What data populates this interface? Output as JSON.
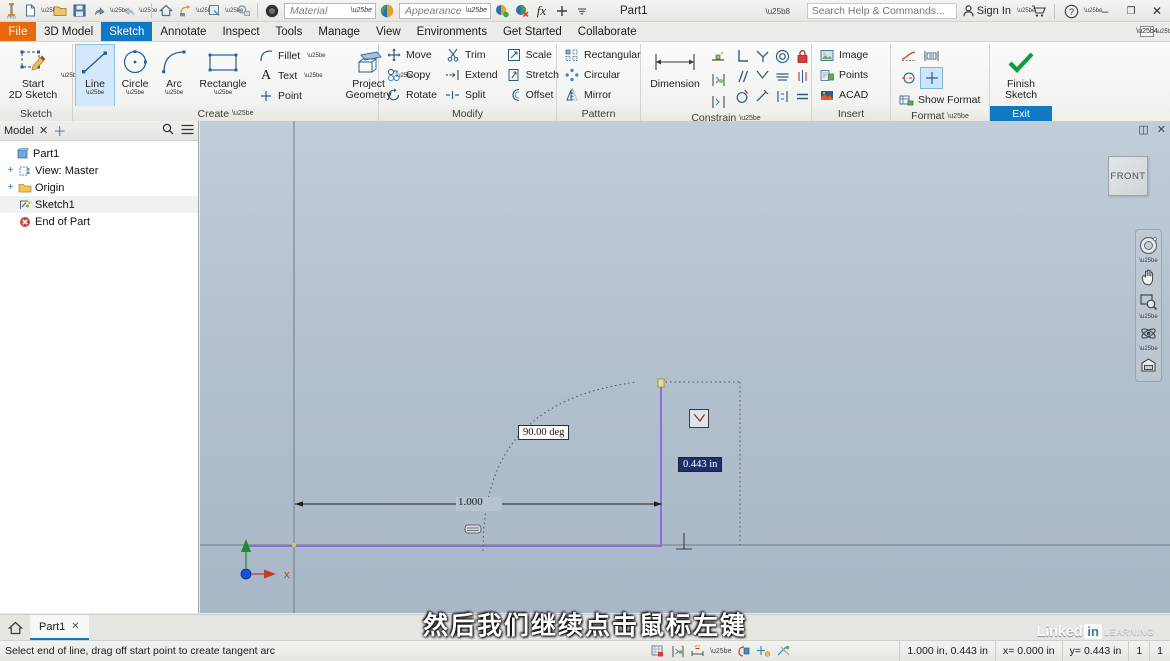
{
  "titlebar": {
    "document_title": "Part1",
    "material_value": "Material",
    "appearance_value": "Appearance",
    "search_placeholder": "Search Help & Commands...",
    "signin_label": "Sign In",
    "minimize_label": "–",
    "restore_label": "❐",
    "close_label": "✕",
    "fx_label": "fx",
    "quick_access": [
      {
        "name": "new-document",
        "glyph": "□"
      },
      {
        "name": "open-document",
        "glyph": "🗁"
      },
      {
        "name": "save-document",
        "glyph": "💾"
      },
      {
        "name": "undo",
        "glyph": "↶"
      },
      {
        "name": "redo",
        "glyph": "↷"
      },
      {
        "name": "home-view",
        "glyph": "⌂"
      },
      {
        "name": "return",
        "glyph": "↩"
      },
      {
        "name": "update",
        "glyph": "◱"
      },
      {
        "name": "select",
        "glyph": "⬚"
      },
      {
        "name": "material-sphere",
        "glyph": "●"
      }
    ]
  },
  "menubar": {
    "file_label": "File",
    "tabs": [
      {
        "label": "3D Model",
        "active": false
      },
      {
        "label": "Sketch",
        "active": true
      },
      {
        "label": "Annotate",
        "active": false
      },
      {
        "label": "Inspect",
        "active": false
      },
      {
        "label": "Tools",
        "active": false
      },
      {
        "label": "Manage",
        "active": false
      },
      {
        "label": "View",
        "active": false
      },
      {
        "label": "Environments",
        "active": false
      },
      {
        "label": "Get Started",
        "active": false
      },
      {
        "label": "Collaborate",
        "active": false
      }
    ]
  },
  "ribbon": {
    "panels": {
      "sketch": {
        "label": "Sketch",
        "start_2d_sketch": "Start\n2D Sketch"
      },
      "create": {
        "label": "Create",
        "line": "Line",
        "circle": "Circle",
        "arc": "Arc",
        "rectangle": "Rectangle",
        "fillet": "Fillet",
        "text": "Text",
        "point": "Point",
        "project_geometry": "Project\nGeometry"
      },
      "modify": {
        "label": "Modify",
        "items": [
          "Move",
          "Copy",
          "Rotate",
          "Trim",
          "Extend",
          "Split",
          "Scale",
          "Stretch",
          "Offset"
        ]
      },
      "pattern": {
        "label": "Pattern",
        "items": [
          "Rectangular",
          "Circular",
          "Mirror"
        ]
      },
      "constrain": {
        "label": "Constrain",
        "dimension": "Dimension"
      },
      "insert": {
        "label": "Insert",
        "items": [
          "Image",
          "Points",
          "ACAD"
        ]
      },
      "format": {
        "label": "Format",
        "show_format": "Show Format"
      },
      "exit": {
        "finish_sketch": "Finish\nSketch",
        "exit_label": "Exit"
      }
    }
  },
  "browser": {
    "title": "Model",
    "close_glyph": "✕",
    "add_glyph": "＋",
    "search_glyph": "⌕",
    "menu_glyph": "☰",
    "tree": [
      {
        "label": "Part1",
        "depth": 0,
        "expander": "",
        "icon": "part-icon",
        "highlight": false
      },
      {
        "label": "View: Master",
        "depth": 1,
        "expander": "+",
        "icon": "view-icon",
        "highlight": false
      },
      {
        "label": "Origin",
        "depth": 1,
        "expander": "+",
        "icon": "folder-icon",
        "highlight": false
      },
      {
        "label": "Sketch1",
        "depth": 1,
        "expander": "",
        "icon": "sketch-icon",
        "highlight": true
      },
      {
        "label": "End of Part",
        "depth": 1,
        "expander": "",
        "icon": "end-of-part-icon",
        "highlight": false
      }
    ]
  },
  "canvas": {
    "viewcube_face": "FRONT",
    "restore_panel_glyph": "◫",
    "close_panel_glyph": "✕",
    "axis_x_label": "x",
    "sketch": {
      "horizontal_dimension": "1.000",
      "angle_dimension": "90.00 deg",
      "length_dimension_editing": "0.443 in"
    },
    "nav_buttons": [
      {
        "name": "full-navigation-wheel-button",
        "glyph": "◎"
      },
      {
        "name": "pan-button",
        "glyph": "✋"
      },
      {
        "name": "zoom-button",
        "glyph": "❐"
      },
      {
        "name": "orbit-button",
        "glyph": "✲"
      },
      {
        "name": "look-at-button",
        "glyph": "▣"
      }
    ]
  },
  "subtitle": {
    "text": "然后我们继续点击鼠标左键"
  },
  "doctabs": {
    "home_glyph": "⌂",
    "tabs": [
      {
        "label": "Part1",
        "close": "✕"
      }
    ]
  },
  "statusbar": {
    "message": "Select end of line, drag off start point to create tangent arc",
    "cells": [
      {
        "name": "dimension-readout",
        "text": "1.000 in, 0.443 in"
      },
      {
        "name": "x-coordinate",
        "text": "x= 0.000 in"
      },
      {
        "name": "y-coordinate",
        "text": "y= 0.443 in"
      },
      {
        "name": "dof-count-1",
        "text": "1"
      },
      {
        "name": "dof-count-2",
        "text": "1"
      }
    ]
  },
  "watermark": {
    "brand": "Linked",
    "brand_in": "in",
    "sub": "LEARNING"
  },
  "colors": {
    "file_orange": "#e8690b",
    "tab_blue": "#1178c4",
    "sketch_line_purple": "#8a6fd4",
    "canvas_top": "#c2cdd8",
    "canvas_bottom": "#a9b8c8",
    "finish_green": "#0f9d3a"
  }
}
